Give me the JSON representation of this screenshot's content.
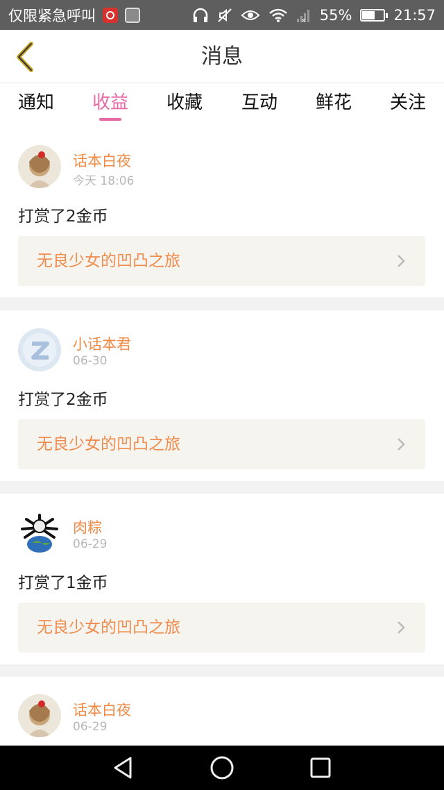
{
  "status_bar": {
    "carrier": "仅限紧急呼叫",
    "battery": "55%",
    "time": "21:57",
    "icons": [
      "netease-music-icon",
      "gallery-icon",
      "headphone-icon",
      "mute-icon",
      "eye-icon",
      "wifi-icon",
      "signal-icon",
      "battery-icon"
    ]
  },
  "header": {
    "title": "消息",
    "back_icon": "back-chevron-icon"
  },
  "tabs": [
    {
      "label": "通知",
      "active": false
    },
    {
      "label": "收益",
      "active": true
    },
    {
      "label": "收藏",
      "active": false
    },
    {
      "label": "互动",
      "active": false
    },
    {
      "label": "鲜花",
      "active": false
    },
    {
      "label": "关注",
      "active": false
    }
  ],
  "items": [
    {
      "user": "话本白夜",
      "time": "今天 18:06",
      "action": "打赏了2金币",
      "book": "无良少女的凹凸之旅",
      "avatar": "girl-photo"
    },
    {
      "user": "小话本君",
      "time": "06-30",
      "action": "打赏了2金币",
      "book": "无良少女的凹凸之旅",
      "avatar": "default-z-avatar"
    },
    {
      "user": "肉粽",
      "time": "06-29",
      "action": "打赏了1金币",
      "book": "无良少女的凹凸之旅",
      "avatar": "earth-skull-avatar"
    },
    {
      "user": "话本白夜",
      "time": "06-29",
      "action": "",
      "book": "",
      "avatar": "girl-photo"
    }
  ],
  "colors": {
    "accent": "#e56aa5",
    "username": "#f08a44",
    "book": "#ef8c4e",
    "linkbox_bg": "#f5f4ef"
  }
}
